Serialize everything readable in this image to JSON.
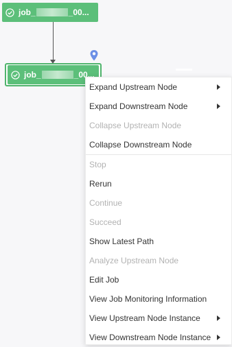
{
  "nodes": [
    {
      "prefix": "job_",
      "suffix": "_00..."
    },
    {
      "prefix": "job_",
      "suffix": "_00..."
    }
  ],
  "colors": {
    "node": "#5cbf7a",
    "node_selected_border": "#4fb46c",
    "pin": "#6b8fe6"
  },
  "icons": {
    "node_status": "check-circle-icon",
    "pin": "location-pin-icon",
    "submenu": "caret-right-icon"
  },
  "menu": {
    "items": [
      {
        "label": "Expand Upstream Node",
        "disabled": false,
        "submenu": true
      },
      {
        "label": "Expand Downstream Node",
        "disabled": false,
        "submenu": true
      },
      {
        "label": "Collapse Upstream Node",
        "disabled": true,
        "submenu": false
      },
      {
        "label": "Collapse Downstream Node",
        "disabled": false,
        "submenu": false
      },
      {
        "label": "Stop",
        "disabled": true,
        "submenu": false
      },
      {
        "label": "Rerun",
        "disabled": false,
        "submenu": false
      },
      {
        "label": "Continue",
        "disabled": true,
        "submenu": false
      },
      {
        "label": "Succeed",
        "disabled": true,
        "submenu": false
      },
      {
        "label": "Show Latest Path",
        "disabled": false,
        "submenu": false
      },
      {
        "label": "Analyze Upstream Node",
        "disabled": true,
        "submenu": false
      },
      {
        "label": "Edit Job",
        "disabled": false,
        "submenu": false
      },
      {
        "label": "View Job Monitoring Information",
        "disabled": false,
        "submenu": false
      },
      {
        "label": "View Upstream Node Instance",
        "disabled": false,
        "submenu": true
      },
      {
        "label": "View Downstream Node Instance",
        "disabled": false,
        "submenu": true
      }
    ]
  }
}
